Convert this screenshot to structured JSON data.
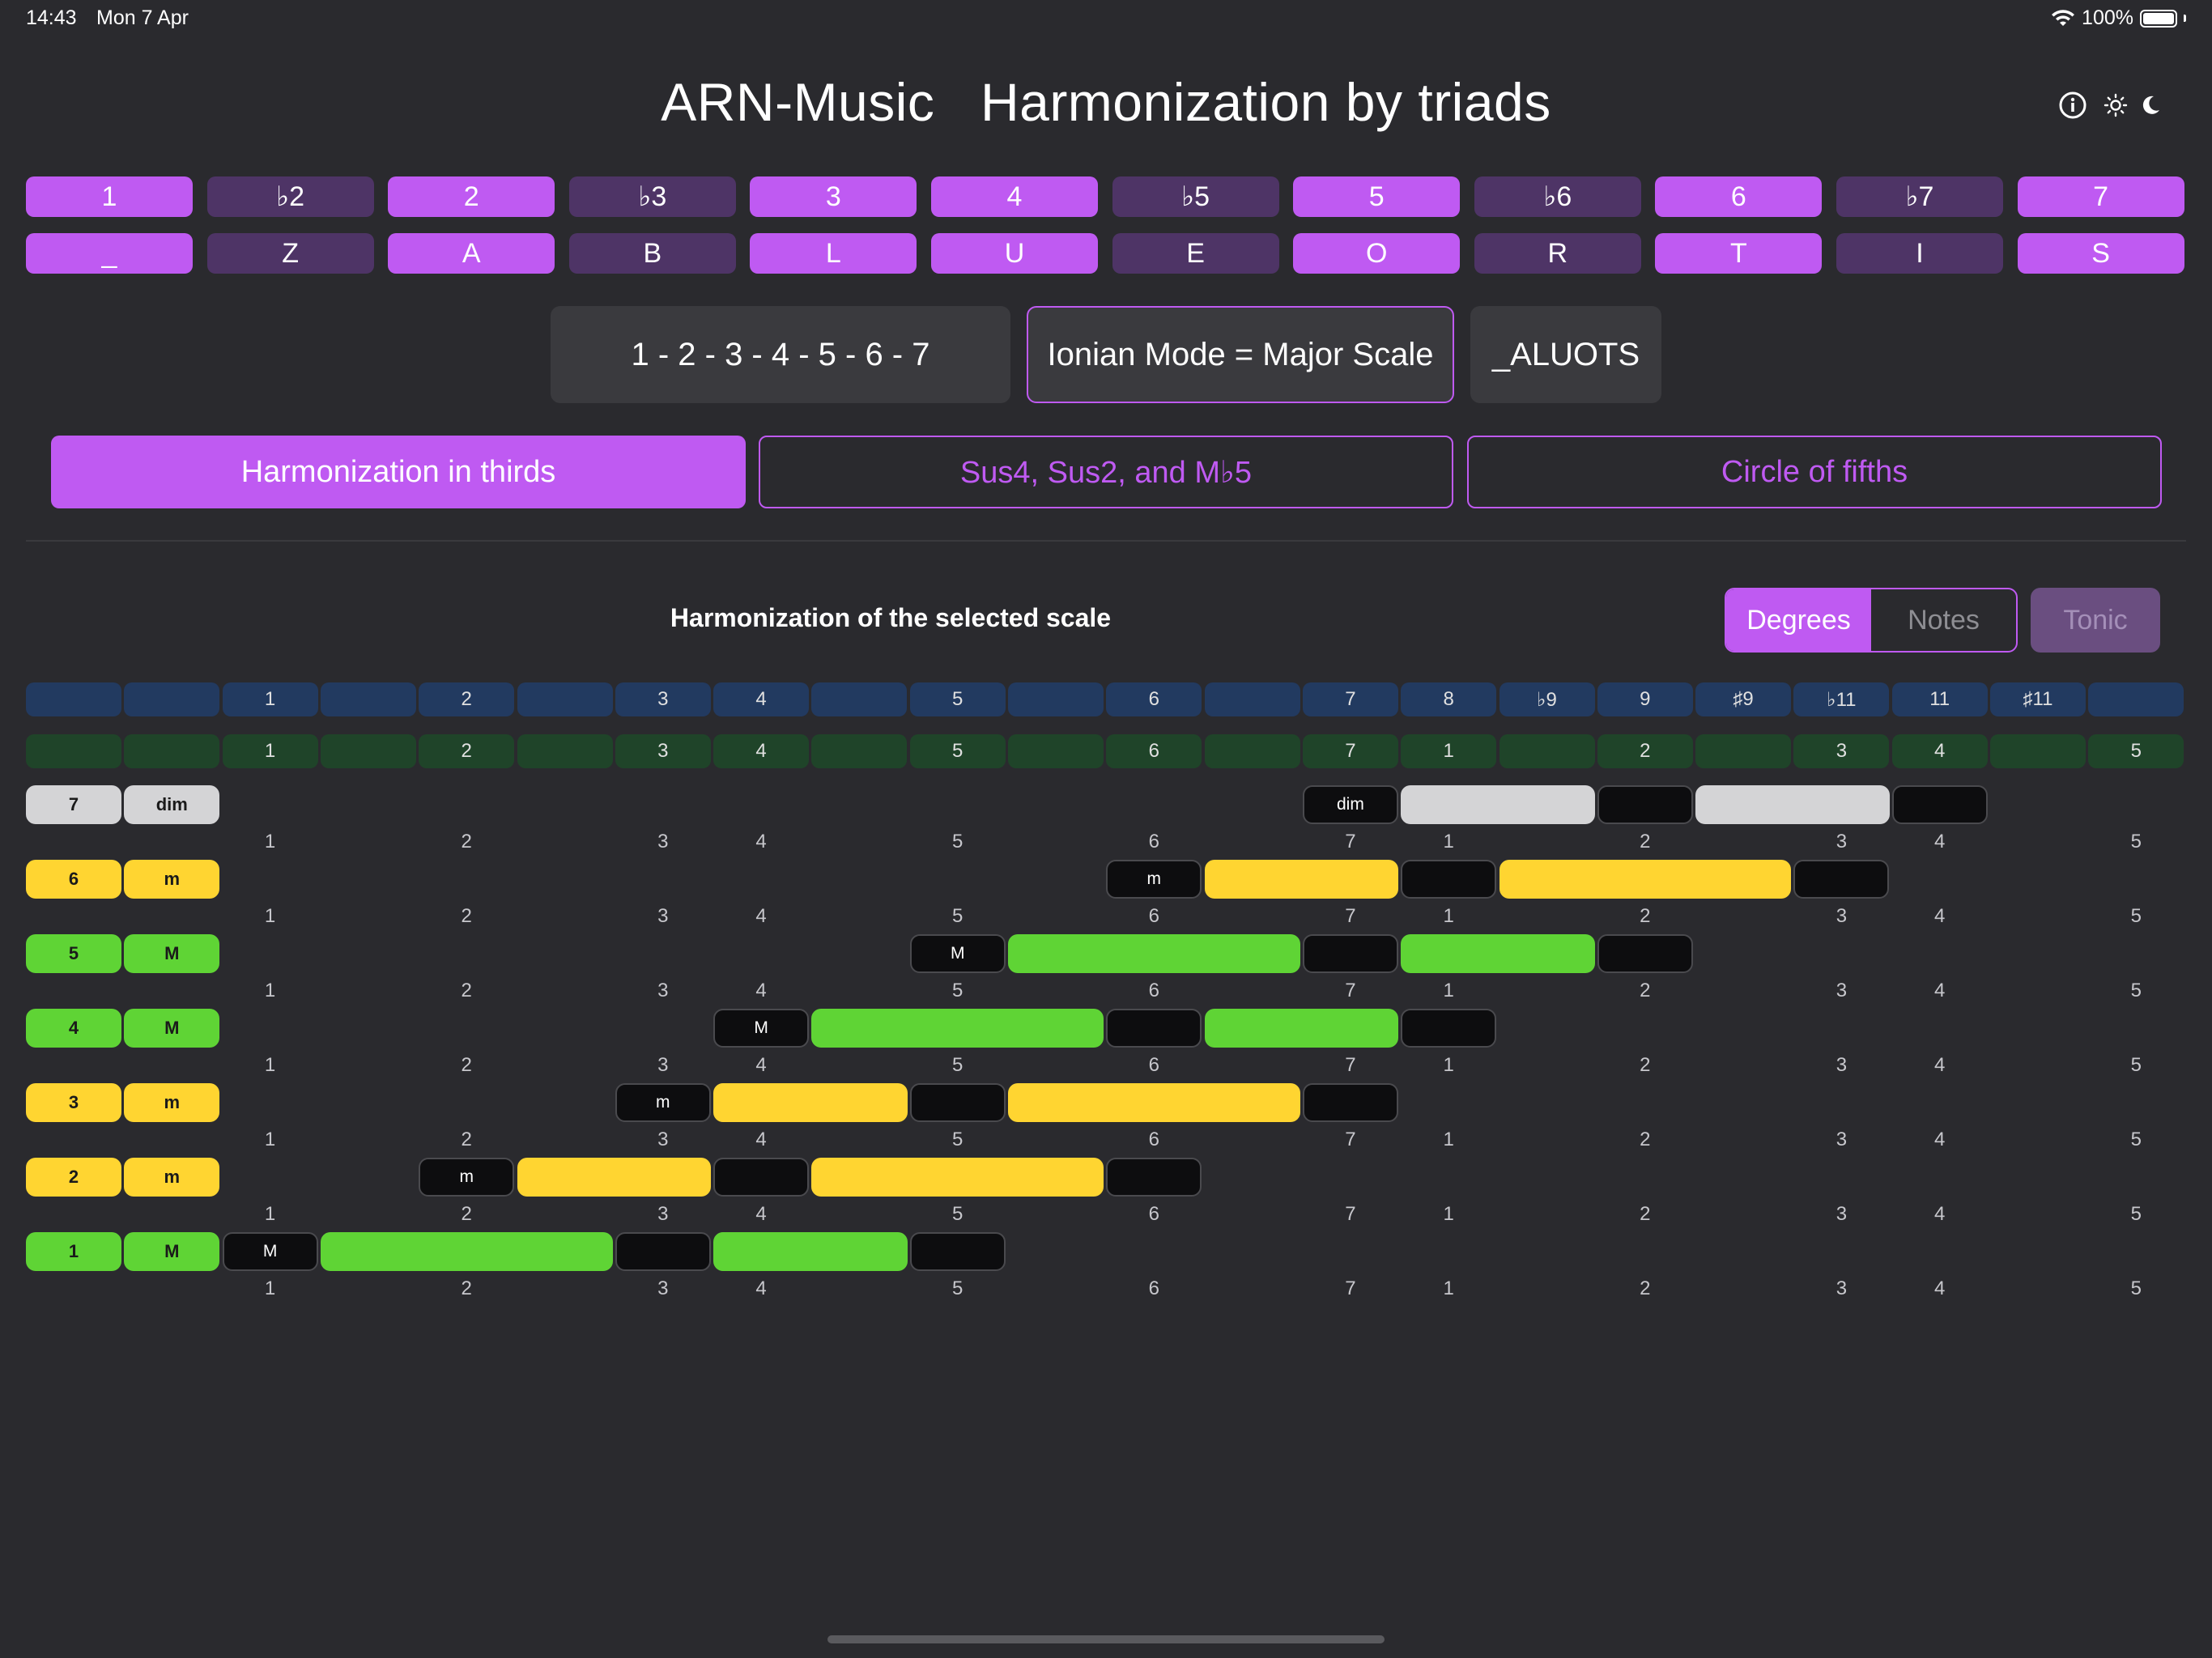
{
  "status": {
    "time": "14:43",
    "date": "Mon 7 Apr",
    "battery": "100%"
  },
  "header": {
    "app_name": "ARN-Music",
    "title": "Harmonization by triads",
    "info_icon": "info-circle-icon",
    "light_icon": "sun-icon",
    "dark_icon": "moon-icon"
  },
  "degree_keys": [
    {
      "label": "1",
      "active": true
    },
    {
      "label": "♭2",
      "active": false
    },
    {
      "label": "2",
      "active": true
    },
    {
      "label": "♭3",
      "active": false
    },
    {
      "label": "3",
      "active": true
    },
    {
      "label": "4",
      "active": true
    },
    {
      "label": "♭5",
      "active": false
    },
    {
      "label": "5",
      "active": true
    },
    {
      "label": "♭6",
      "active": false
    },
    {
      "label": "6",
      "active": true
    },
    {
      "label": "♭7",
      "active": false
    },
    {
      "label": "7",
      "active": true
    }
  ],
  "letter_keys": [
    "_",
    "Z",
    "A",
    "B",
    "L",
    "U",
    "E",
    "O",
    "R",
    "T",
    "I",
    "S"
  ],
  "scale_info": {
    "degrees": "1 - 2 - 3 - 4 - 5 - 6 - 7",
    "mode_name": "Ionian Mode = Major Scale",
    "code": "_ALUOTS"
  },
  "modes": [
    {
      "label": "Harmonization in thirds",
      "active": true
    },
    {
      "label": "Sus4, Sus2, and M♭5",
      "active": false
    },
    {
      "label": "Circle of fifths",
      "active": false
    }
  ],
  "section": {
    "title": "Harmonization of the selected scale",
    "seg_degrees": "Degrees",
    "seg_notes": "Notes",
    "tonic": "Tonic"
  },
  "interval_header": [
    "",
    "",
    "1",
    "",
    "2",
    "",
    "3",
    "4",
    "",
    "5",
    "",
    "6",
    "",
    "7",
    "8",
    "♭9",
    "9",
    "♯9",
    "♭11",
    "11",
    "♯11",
    ""
  ],
  "scale_header": [
    "",
    "",
    "1",
    "",
    "2",
    "",
    "3",
    "4",
    "",
    "5",
    "",
    "6",
    "",
    "7",
    "1",
    "",
    "2",
    "",
    "3",
    "4",
    "",
    "5"
  ],
  "number_row": [
    "1",
    "2",
    "3",
    "4",
    "5",
    "6",
    "7",
    "1",
    "2",
    "3",
    "4",
    "5"
  ],
  "chords": [
    {
      "degree": "7",
      "quality": "dim",
      "color": "#d4d4d6"
    },
    {
      "degree": "6",
      "quality": "m",
      "color": "#ffd531"
    },
    {
      "degree": "5",
      "quality": "M",
      "color": "#5fd435"
    },
    {
      "degree": "4",
      "quality": "M",
      "color": "#5fd435"
    },
    {
      "degree": "3",
      "quality": "m",
      "color": "#ffd531"
    },
    {
      "degree": "2",
      "quality": "m",
      "color": "#ffd531"
    },
    {
      "degree": "1",
      "quality": "M",
      "color": "#5fd435"
    }
  ],
  "colors": {
    "accent": "#bf5af2",
    "major": "#5fd435",
    "minor": "#ffd531",
    "dim": "#d4d4d6"
  }
}
